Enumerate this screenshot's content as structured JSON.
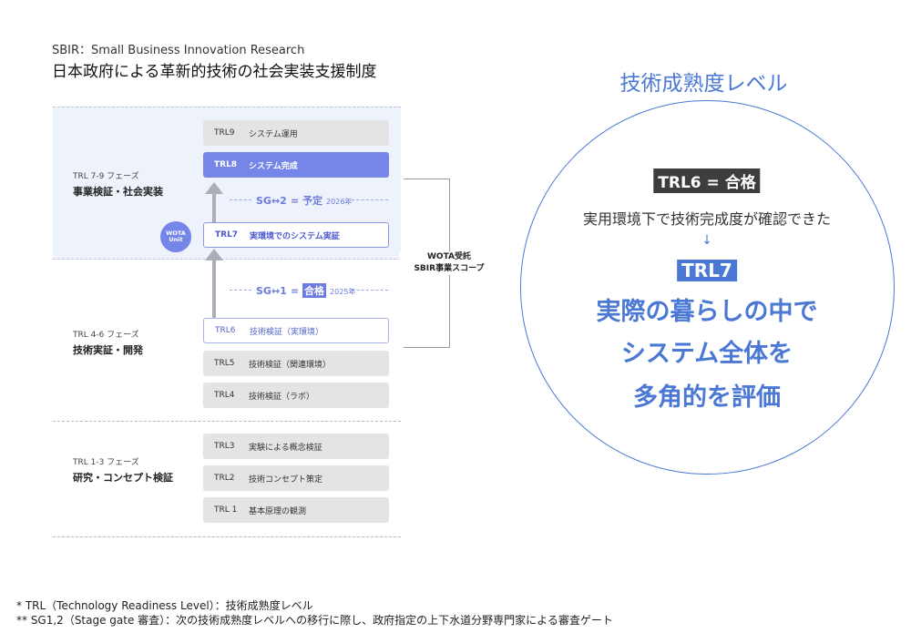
{
  "header": {
    "subtitle": "SBIR：Small Business Innovation Research",
    "title": "日本政府による革新的技術の社会実装支援制度"
  },
  "phases": [
    {
      "code": "TRL 7-9  フェーズ",
      "name": "事業検証・社会実装"
    },
    {
      "code": "TRL 4-6  フェーズ",
      "name": "技術実証・開発"
    },
    {
      "code": "TRL 1-3  フェーズ",
      "name": "研究・コンセプト検証"
    }
  ],
  "levels": [
    {
      "code": "TRL9",
      "label": "システム運用"
    },
    {
      "code": "TRL8",
      "label": "システム完成"
    },
    {
      "code": "TRL7",
      "label": "実環境でのシステム実証"
    },
    {
      "code": "TRL6",
      "label": "技術検証（実環境）"
    },
    {
      "code": "TRL5",
      "label": "技術検証（関連環境）"
    },
    {
      "code": "TRL4",
      "label": "技術検証（ラボ）"
    },
    {
      "code": "TRL3",
      "label": "実験による概念検証"
    },
    {
      "code": "TRL2",
      "label": "技術コンセプト策定"
    },
    {
      "code": "TRL 1",
      "label": "基本原理の観測"
    }
  ],
  "stage_gates": {
    "sg2": {
      "label": "SG↔2",
      "eq": "=",
      "status": "予定",
      "year": "2026年"
    },
    "sg1": {
      "label": "SG↔1",
      "eq": "=",
      "status": "合格",
      "year": "2025年"
    }
  },
  "badge": {
    "line1": "WOTA",
    "line2": "Unit"
  },
  "scope": {
    "line1": "WOTA受託",
    "line2": "SBIR事業スコープ"
  },
  "right": {
    "title": "技術成熟度レベル",
    "trl6": "TRL6 = 合格",
    "desc": "実用環境下で技術完成度が確認できた",
    "arrow": "↓",
    "trl7": "TRL7",
    "line1": "実際の暮らしの中で",
    "line2": "システム全体を",
    "line3": "多角的を評価"
  },
  "footnotes": {
    "note1": "* TRL（Technology Readiness Level）：技術成熟度レベル",
    "note2": "** SG1,2（Stage gate 審査）：次の技術成熟度レベルへの移行に際し、政府指定の上下水道分野専門家による審査ゲート"
  },
  "colors": {
    "accent": "#4a78d4",
    "box_active": "#7585e8",
    "box_gray": "#e4e4e6",
    "band": "#eef2fb"
  }
}
